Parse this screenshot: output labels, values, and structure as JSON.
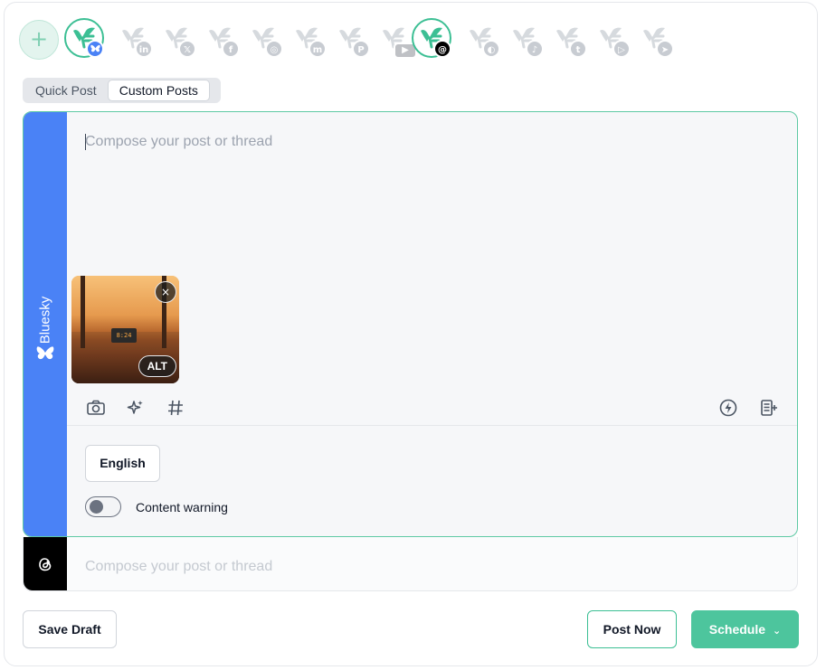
{
  "add_account": {
    "symbol": "+"
  },
  "accounts": [
    {
      "network": "bluesky",
      "badge": "",
      "active": true
    },
    {
      "network": "linkedin",
      "badge": "in",
      "active": false
    },
    {
      "network": "x",
      "badge": "𝕏",
      "active": false
    },
    {
      "network": "facebook",
      "badge": "f",
      "active": false
    },
    {
      "network": "instagram",
      "badge": "◎",
      "active": false
    },
    {
      "network": "mastodon",
      "badge": "m",
      "active": false
    },
    {
      "network": "pinterest",
      "badge": "P",
      "active": false
    },
    {
      "network": "youtube",
      "badge": "▶",
      "active": false
    },
    {
      "network": "threads",
      "badge": "@",
      "active": true
    },
    {
      "network": "google-business",
      "badge": "◐",
      "active": false
    },
    {
      "network": "tiktok",
      "badge": "♪",
      "active": false
    },
    {
      "network": "tumblr",
      "badge": "t",
      "active": false
    },
    {
      "network": "google-play",
      "badge": "▷",
      "active": false
    },
    {
      "network": "telegram",
      "badge": "➤",
      "active": false
    }
  ],
  "tabs": [
    {
      "label": "Quick Post",
      "active": false
    },
    {
      "label": "Custom Posts",
      "active": true
    }
  ],
  "bluesky_editor": {
    "platform_label": "Bluesky",
    "placeholder": "Compose your post or thread",
    "image": {
      "close_symbol": "×",
      "alt_label": "ALT",
      "clock_text": "8:24"
    },
    "language_button": "English",
    "content_warning_label": "Content warning",
    "content_warning_enabled": false,
    "colors": {
      "accent": "#4a82f6"
    }
  },
  "threads_editor": {
    "placeholder": "Compose your post or thread"
  },
  "footer": {
    "save_draft": "Save Draft",
    "post_now": "Post Now",
    "schedule": "Schedule"
  },
  "colors": {
    "brand": "#4dc59d",
    "bluesky": "#4a82f6",
    "threads": "#000000"
  }
}
